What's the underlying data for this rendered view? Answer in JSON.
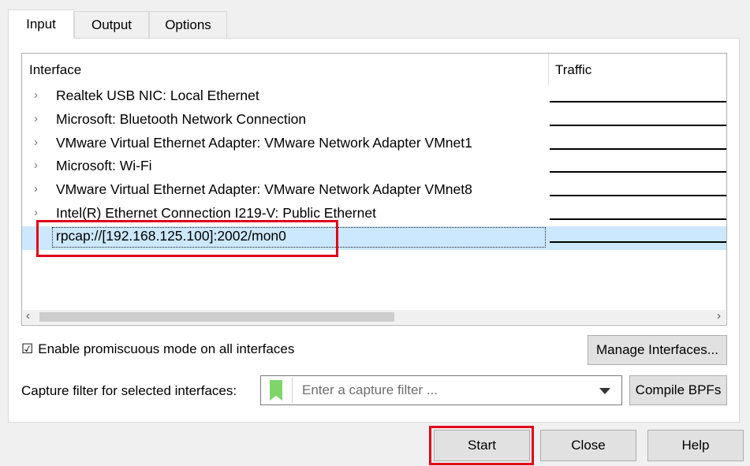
{
  "tabs": [
    {
      "label": "Input",
      "active": true
    },
    {
      "label": "Output",
      "active": false
    },
    {
      "label": "Options",
      "active": false
    }
  ],
  "interface_list": {
    "columns": {
      "interface": "Interface",
      "traffic": "Traffic"
    },
    "rows": [
      {
        "name": "Realtek USB NIC: Local Ethernet",
        "expandable": true
      },
      {
        "name": "Microsoft: Bluetooth Network Connection",
        "expandable": true
      },
      {
        "name": "VMware Virtual Ethernet Adapter: VMware Network Adapter VMnet1",
        "expandable": true
      },
      {
        "name": "Microsoft: Wi-Fi",
        "expandable": true
      },
      {
        "name": "VMware Virtual Ethernet Adapter: VMware Network Adapter VMnet8",
        "expandable": true
      },
      {
        "name": "Intel(R) Ethernet Connection I219-V: Public Ethernet",
        "expandable": true
      },
      {
        "name": "rpcap://[192.168.125.100]:2002/mon0",
        "expandable": false,
        "selected": true
      }
    ],
    "expand_icon": "chevron-right-icon"
  },
  "promiscuous": {
    "label": "Enable promiscuous mode on all interfaces",
    "checked": true
  },
  "manage_interfaces_label": "Manage Interfaces...",
  "capture_filter": {
    "label": "Capture filter for selected interfaces:",
    "placeholder": "Enter a capture filter ...",
    "bookmark_color": "#7fd46a"
  },
  "compile_bpfs_label": "Compile BPFs",
  "buttons": {
    "start": "Start",
    "close": "Close",
    "help": "Help"
  },
  "colors": {
    "highlight": "#e0001a",
    "selection": "#cce8ff"
  }
}
